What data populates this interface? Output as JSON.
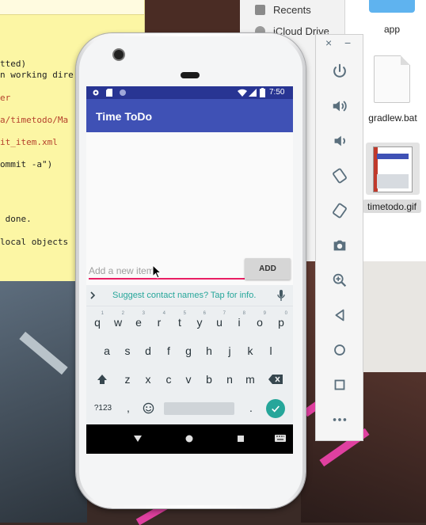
{
  "finder": {
    "sidebar_recents": "Recents",
    "sidebar_icloud": "iCloud Drive",
    "file_app": "app",
    "file_gradlew": "gradlew.bat",
    "file_timetodo": "timetodo.gif"
  },
  "terminal_lines": [
    {
      "text": "tted)",
      "color": "black"
    },
    {
      "text": "n working dire",
      "color": "black"
    },
    {
      "text": "er",
      "color": "red"
    },
    {
      "text": "a/timetodo/Ma",
      "color": "red"
    },
    {
      "text": "it_item.xml",
      "color": "red"
    },
    {
      "text": "ommit -a\")",
      "color": "black"
    },
    {
      "text": " done.",
      "color": "black"
    },
    {
      "text": "local objects",
      "color": "black"
    }
  ],
  "phone": {
    "status_time": "7:50",
    "app_title": "Time ToDo",
    "input_placeholder": "Add a new item",
    "add_button": "ADD",
    "suggestion": "Suggest contact names? Tap for info.",
    "keyboard_rows": [
      [
        "q",
        "w",
        "e",
        "r",
        "t",
        "y",
        "u",
        "i",
        "o",
        "p"
      ],
      [
        "a",
        "s",
        "d",
        "f",
        "g",
        "h",
        "j",
        "k",
        "l"
      ],
      [
        "z",
        "x",
        "c",
        "v",
        "b",
        "n",
        "m"
      ]
    ],
    "key_hints": [
      "1",
      "2",
      "3",
      "4",
      "5",
      "6",
      "7",
      "8",
      "9",
      "0"
    ],
    "symbols_key": "?123",
    "comma_key": ",",
    "period_key": ".",
    "accent_color": "#3f51b5",
    "status_color": "#283593",
    "underline_color": "#e91e63",
    "suggest_color": "#26a69a"
  },
  "emulator_toolbar": {
    "close_icon": "×",
    "minimize_icon": "−",
    "buttons": [
      "power-icon",
      "volume-up-icon",
      "volume-down-icon",
      "rotate-left-icon",
      "rotate-right-icon",
      "camera-icon",
      "zoom-icon",
      "back-icon",
      "home-icon",
      "overview-icon",
      "more-icon"
    ]
  }
}
